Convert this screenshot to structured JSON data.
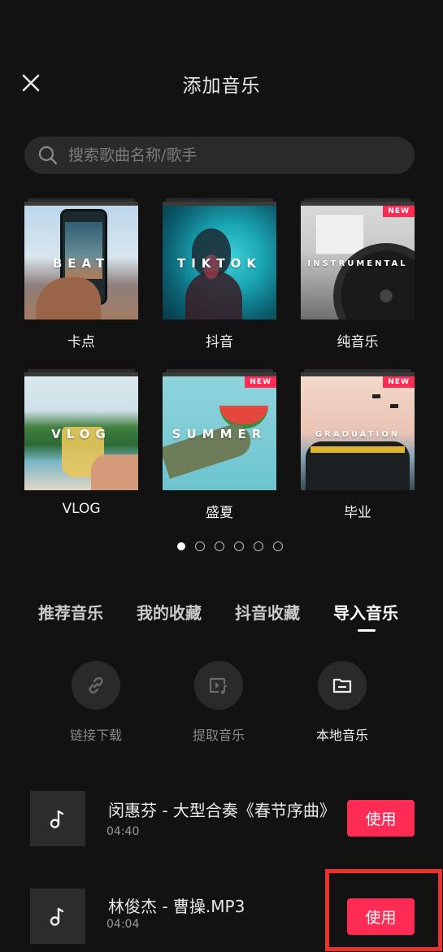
{
  "header": {
    "title": "添加音乐"
  },
  "search": {
    "placeholder": "搜索歌曲名称/歌手"
  },
  "categories": [
    {
      "label": "卡点",
      "overlay": "BEAT",
      "badge": ""
    },
    {
      "label": "抖音",
      "overlay": "TIKTOK",
      "badge": ""
    },
    {
      "label": "纯音乐",
      "overlay": "INSTRUMENTAL",
      "badge": "NEW"
    },
    {
      "label": "VLOG",
      "overlay": "VLOG",
      "badge": ""
    },
    {
      "label": "盛夏",
      "overlay": "SUMMER",
      "badge": "NEW"
    },
    {
      "label": "毕业",
      "overlay": "GRADUATION",
      "badge": "NEW"
    }
  ],
  "pager": {
    "pages": 6,
    "current": 1
  },
  "tabs": [
    {
      "label": "推荐音乐"
    },
    {
      "label": "我的收藏"
    },
    {
      "label": "抖音收藏"
    },
    {
      "label": "导入音乐",
      "active": true
    }
  ],
  "import_actions": [
    {
      "label": "链接下载",
      "icon": "link-icon"
    },
    {
      "label": "提取音乐",
      "icon": "video-music-icon"
    },
    {
      "label": "本地音乐",
      "icon": "folder-icon"
    }
  ],
  "songs": [
    {
      "title": "闵惠芬 - 大型合奏《春节序曲》",
      "duration": "04:40",
      "action": "使用"
    },
    {
      "title": "林俊杰 - 曹操.MP3",
      "duration": "04:04",
      "action": "使用"
    }
  ],
  "colors": {
    "background": "#121212",
    "accent": "#fe2c55",
    "highlight": "#e8322a"
  }
}
